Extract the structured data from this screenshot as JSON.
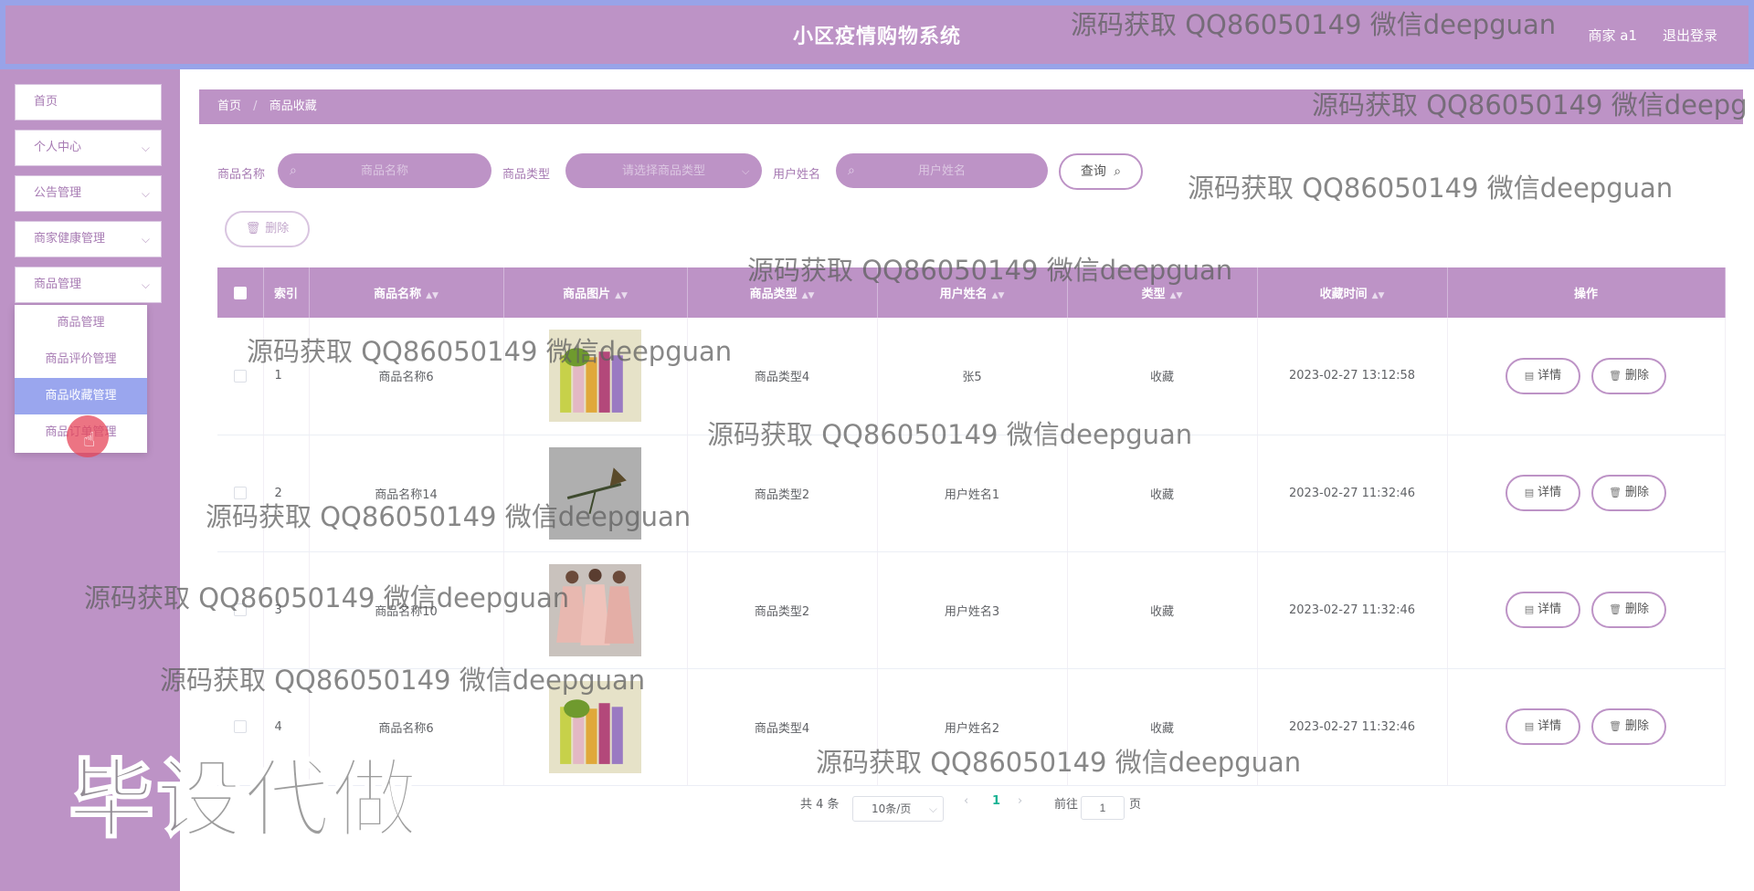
{
  "app": {
    "title": "小区疫情购物系统",
    "user": "商家 a1",
    "logout": "退出登录"
  },
  "sidebar": {
    "items": [
      {
        "label": "首页",
        "chevron": ""
      },
      {
        "label": "个人中心",
        "chevron": "chevron-down-icon"
      },
      {
        "label": "公告管理",
        "chevron": "chevron-down-icon"
      },
      {
        "label": "商家健康管理",
        "chevron": "chevron-down-icon"
      },
      {
        "label": "商品管理",
        "chevron": "chevron-down-icon"
      }
    ],
    "submenu": [
      "商品管理",
      "商品评价管理",
      "商品收藏管理",
      "商品订单管理"
    ],
    "active_submenu": "商品收藏管理"
  },
  "breadcrumb": {
    "home": "首页",
    "separator": "/",
    "current": "商品收藏"
  },
  "search": {
    "name_label": "商品名称",
    "name_placeholder": "商品名称",
    "type_label": "商品类型",
    "type_placeholder": "请选择商品类型",
    "user_label": "用户姓名",
    "user_placeholder": "用户姓名",
    "query_label": "查询"
  },
  "actions": {
    "delete_label": "删除"
  },
  "table": {
    "headers": [
      "索引",
      "商品名称",
      "商品图片",
      "商品类型",
      "用户姓名",
      "类型",
      "收藏时间",
      "操作"
    ],
    "rows": [
      {
        "index": "1",
        "name": "商品名称6",
        "type": "商品类型4",
        "user": "张5",
        "kind": "收藏",
        "time": "2023-02-27 13:12:58"
      },
      {
        "index": "2",
        "name": "商品名称14",
        "type": "商品类型2",
        "user": "用户姓名1",
        "kind": "收藏",
        "time": "2023-02-27 11:32:46"
      },
      {
        "index": "3",
        "name": "商品名称10",
        "type": "商品类型2",
        "user": "用户姓名3",
        "kind": "收藏",
        "time": "2023-02-27 11:32:46"
      },
      {
        "index": "4",
        "name": "商品名称6",
        "type": "商品类型4",
        "user": "用户姓名2",
        "kind": "收藏",
        "time": "2023-02-27 11:32:46"
      }
    ],
    "detail_label": "详情",
    "delete_label": "删除"
  },
  "pagination": {
    "total": "共 4 条",
    "page_size": "10条/页",
    "current_page": "1",
    "goto_prefix": "前往",
    "goto_value": "1",
    "goto_suffix": "页"
  },
  "watermarks": {
    "text": "源码获取 QQ86050149 微信deepguan",
    "clipped": "源码获取 QQ86050149 微信deepg",
    "big": "毕设代做"
  },
  "colors": {
    "header": "#bd93c6",
    "header_border": "#98a3e8",
    "active": "#9aa6ee",
    "cursor": "#e6465a"
  }
}
